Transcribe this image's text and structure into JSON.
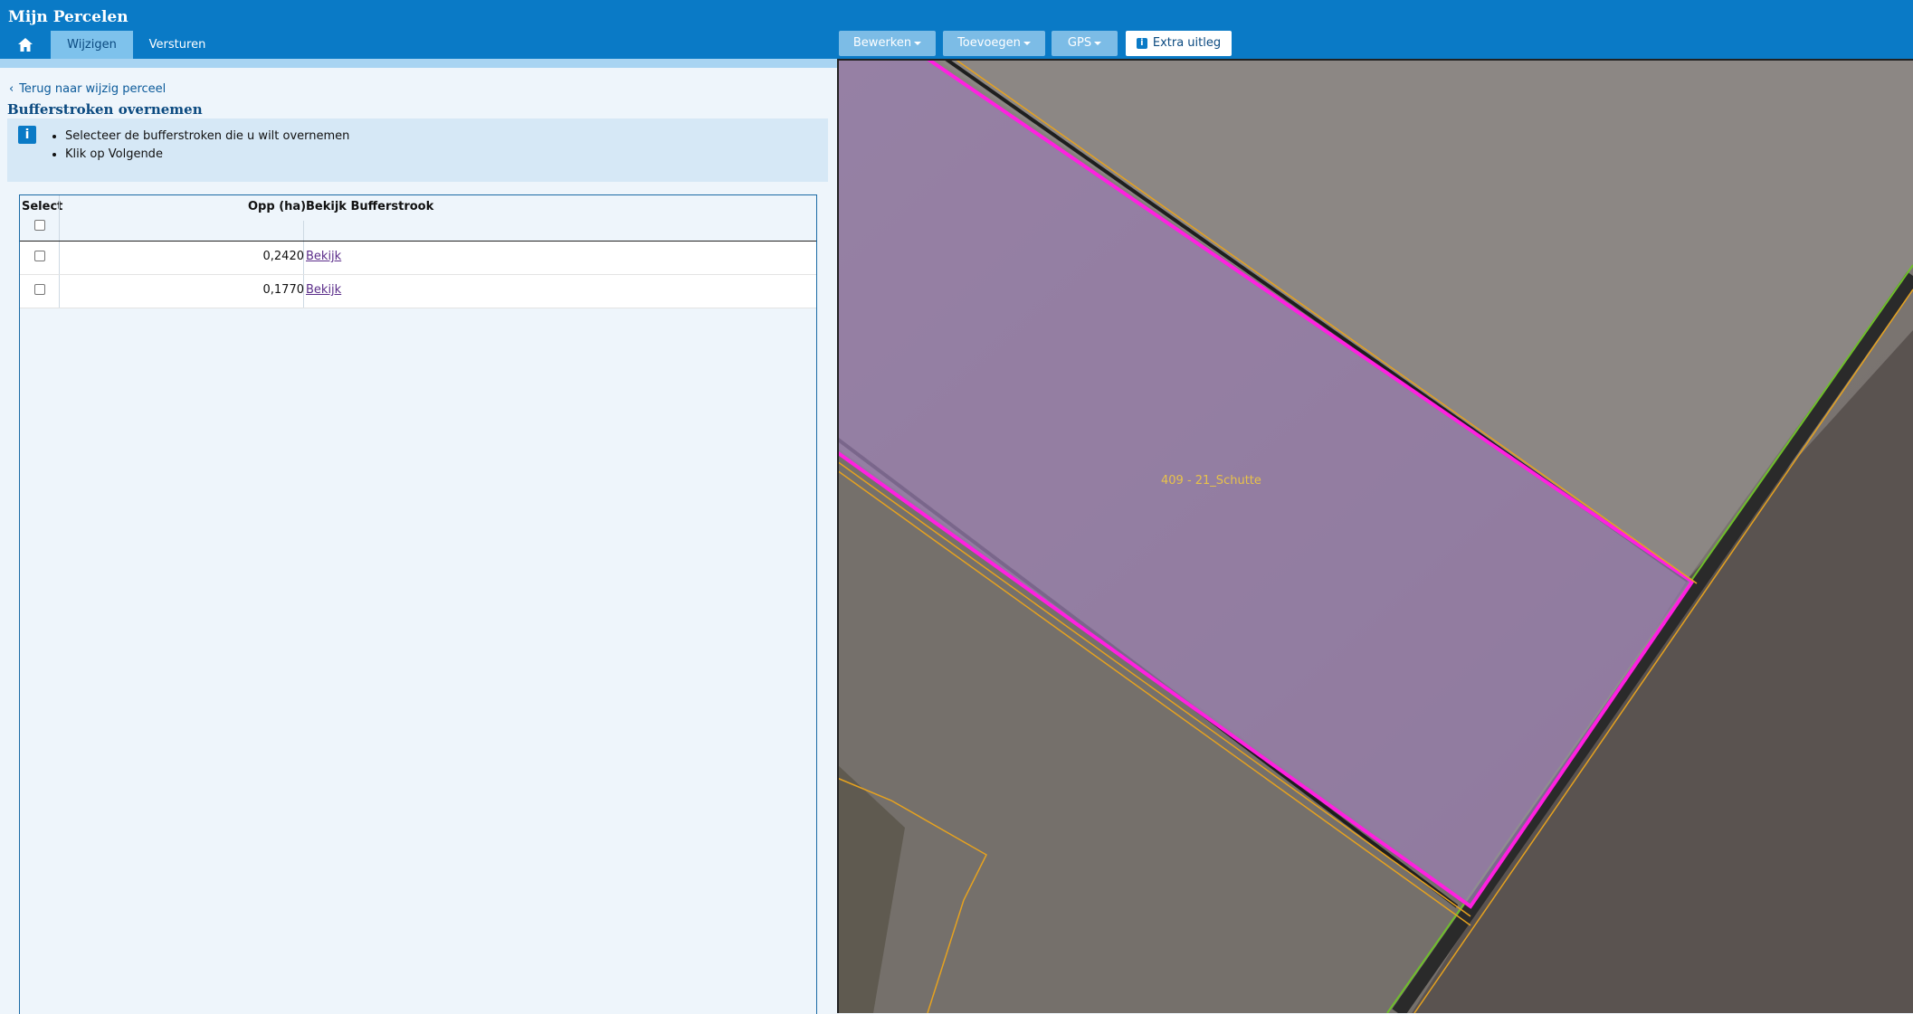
{
  "app": {
    "title": "Mijn Percelen"
  },
  "nav": {
    "tabs": [
      "Wijzigen",
      "Versturen"
    ],
    "active": "Wijzigen"
  },
  "toolbar": {
    "bewerken": "Bewerken",
    "toevoegen": "Toevoegen",
    "gps": "GPS",
    "extra": "Extra uitleg"
  },
  "panel": {
    "back_link": "Terug naar wijzig perceel",
    "title": "Bufferstroken overnemen",
    "instructions": [
      "Selecteer de bufferstroken die u wilt overnemen",
      "Klik op Volgende"
    ]
  },
  "table": {
    "headers": {
      "select": "Select",
      "opp": "Opp (ha)",
      "bekijk": "Bekijk Bufferstrook"
    },
    "rows": [
      {
        "opp": "0,2420",
        "link": "Bekijk",
        "checked": false
      },
      {
        "opp": "0,1770",
        "link": "Bekijk",
        "checked": false
      }
    ]
  },
  "map": {
    "parcel_label": "409 - 21_Schutte",
    "parcel_fill": "#9a7fb0",
    "parcel_border": "#ff20e0",
    "boundary_color": "#e6a21f"
  }
}
